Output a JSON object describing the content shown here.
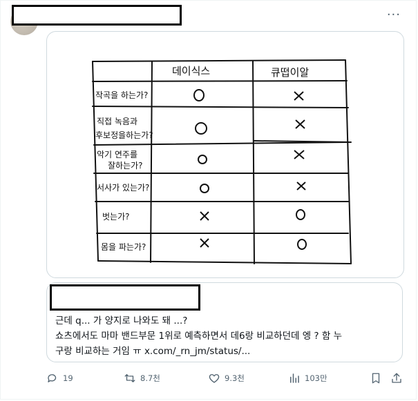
{
  "post": {
    "more_icon": "more-horizontal-icon",
    "quote": {
      "lines": [
        "근데 q... 가 양지로 나와도 돼 ...?",
        "쇼츠에서도 마마 밴드부문 1위로 예측하면서 데6랑 비교하던데 엥 ? 함 누",
        "구랑 비교하는 거임 ㅠ x.com/_rn_jm/status/..."
      ]
    },
    "actions": {
      "reply": {
        "icon": "reply-icon",
        "count": "19"
      },
      "repost": {
        "icon": "repost-icon",
        "count": "8.7천"
      },
      "like": {
        "icon": "heart-icon",
        "count": "9.3천"
      },
      "views": {
        "icon": "views-icon",
        "count": "103만"
      },
      "bookmark": {
        "icon": "bookmark-icon"
      },
      "share": {
        "icon": "share-icon"
      }
    }
  },
  "drawing": {
    "columns": [
      "데이식스",
      "큐떱이알"
    ],
    "rows": [
      {
        "label": "작곡을 하는가?",
        "a": "O",
        "b": "X"
      },
      {
        "label": "직접 녹음과 후보정을 하는가?",
        "a": "O",
        "b": "X"
      },
      {
        "label": "악기 연주를 잘하는가?",
        "a": "O",
        "b": "X"
      },
      {
        "label": "서사가 있는가?",
        "a": "O",
        "b": "X"
      },
      {
        "label": "벗는가?",
        "a": "X",
        "b": "O"
      },
      {
        "label": "몸을 파는가?",
        "a": "X",
        "b": "O"
      }
    ]
  }
}
